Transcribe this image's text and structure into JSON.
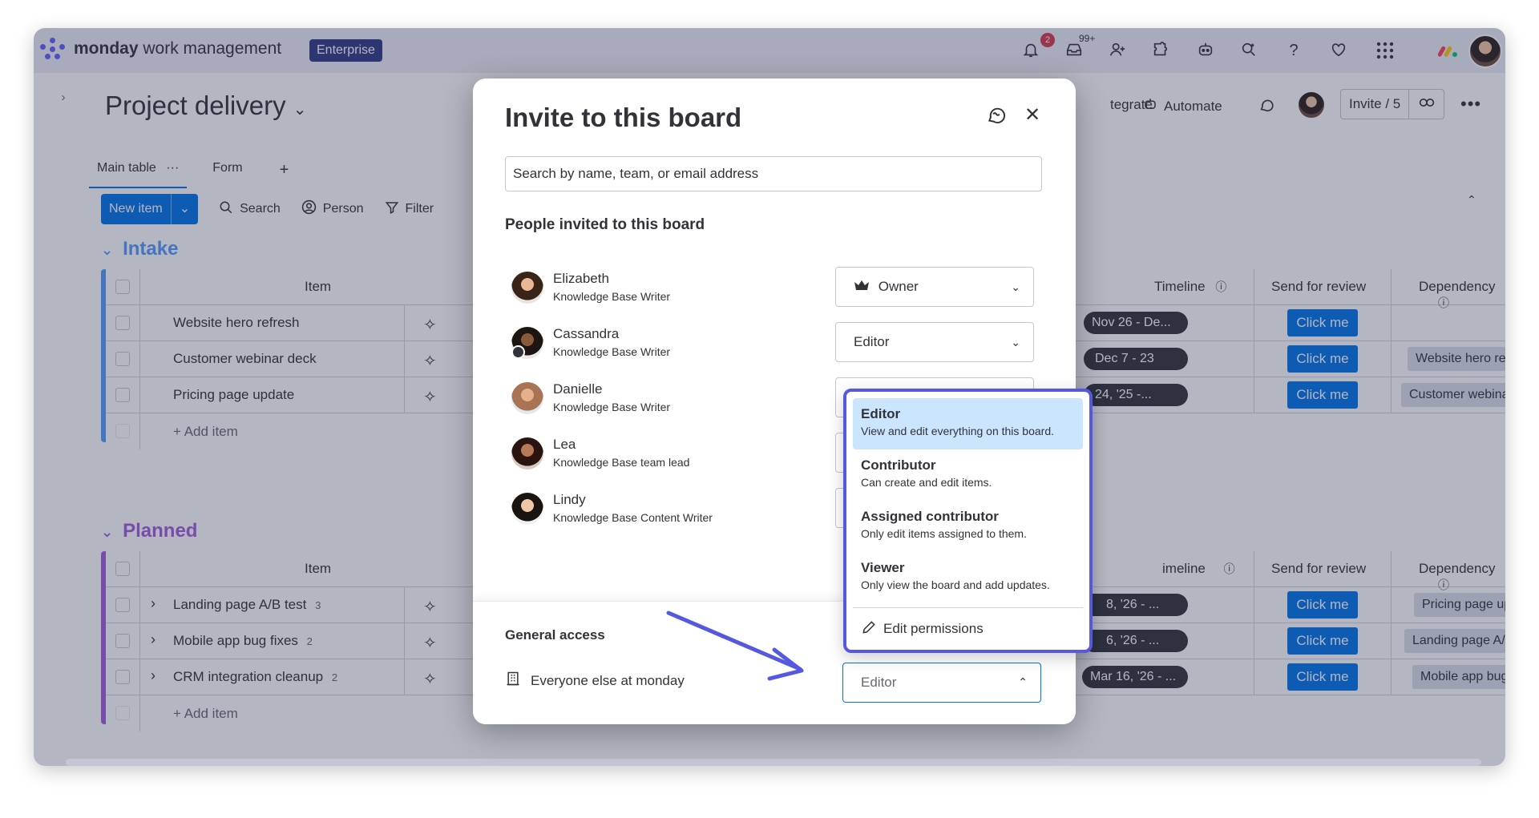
{
  "topbar": {
    "brand_bold": "monday",
    "brand_rest": " work management",
    "plan": "Enterprise",
    "notifications_count": "2",
    "inbox_count": "99+"
  },
  "board": {
    "title": "Project delivery",
    "tabs": [
      "Main table",
      "Form"
    ],
    "toolbar": {
      "new_item": "New item",
      "search": "Search",
      "person": "Person",
      "filter": "Filter"
    },
    "header_actions": {
      "integrate": "tegrate",
      "automate": "Automate",
      "invite": "Invite / 5"
    },
    "columns": {
      "item": "Item",
      "timeline": "Timeline",
      "timeline_cut": "imeline",
      "send_for_review": "Send for review",
      "dependency": "Dependency"
    },
    "groups": [
      {
        "name": "Intake",
        "color": "#579bfc",
        "rows": [
          {
            "item": "Website hero refresh",
            "timeline": "Nov 26 - De...",
            "review": "Click me",
            "dependency": ""
          },
          {
            "item": "Customer webinar deck",
            "timeline": "Dec 7 - 23",
            "review": "Click me",
            "dependency": "Website hero refresh"
          },
          {
            "item": "Pricing page update",
            "timeline": "24, '25 -...",
            "review": "Click me",
            "dependency": "Customer webinar de..."
          }
        ],
        "add_item": "+ Add item"
      },
      {
        "name": "Planned",
        "color": "#a25ddc",
        "rows": [
          {
            "item": "Landing page A/B test",
            "count": "3",
            "timeline": "8, '26 - ...",
            "review": "Click me",
            "dependency": "Pricing page update"
          },
          {
            "item": "Mobile app bug fixes",
            "count": "2",
            "timeline": "6, '26 - ...",
            "review": "Click me",
            "dependency": "Landing page A/B test"
          },
          {
            "item": "CRM integration cleanup",
            "count": "2",
            "timeline": "Mar 16, '26 - ...",
            "review": "Click me",
            "dependency": "Mobile app bug fixes"
          }
        ],
        "add_item": "+ Add item"
      }
    ]
  },
  "modal": {
    "title": "Invite to this board",
    "search_placeholder": "Search by name, team, or email address",
    "people_heading": "People invited to this board",
    "people": [
      {
        "name": "Elizabeth",
        "role": "Knowledge Base Writer",
        "access": "Owner"
      },
      {
        "name": "Cassandra",
        "role": "Knowledge Base Writer",
        "access": "Editor"
      },
      {
        "name": "Danielle",
        "role": "Knowledge Base Writer",
        "access": ""
      },
      {
        "name": "Lea",
        "role": "Knowledge Base team lead",
        "access": ""
      },
      {
        "name": "Lindy",
        "role": "Knowledge Base Content Writer",
        "access": ""
      }
    ],
    "general_access": {
      "heading": "General access",
      "label": "Everyone else at monday",
      "value": "Editor"
    }
  },
  "dropdown": {
    "options": [
      {
        "title": "Editor",
        "desc": "View and edit everything on this board."
      },
      {
        "title": "Contributor",
        "desc": "Can create and edit items."
      },
      {
        "title": "Assigned contributor",
        "desc": "Only edit items assigned to them."
      },
      {
        "title": "Viewer",
        "desc": "Only view the board and add updates."
      }
    ],
    "edit_permissions": "Edit permissions"
  },
  "colors": {
    "primary": "#0073ea",
    "dropdown_border": "#5559df",
    "selected_option": "#cce5ff",
    "annotation_arrow": "#5559df"
  }
}
